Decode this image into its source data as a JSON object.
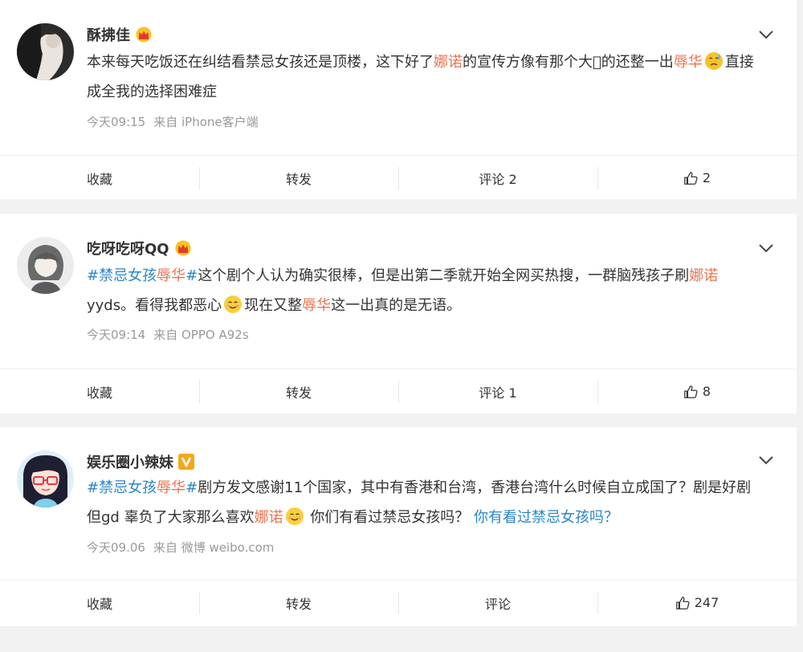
{
  "posts": [
    {
      "username": "酥拂佳",
      "badge": "crown-icon",
      "text": [
        {
          "t": "本来每天吃饭还在纠结看禁忌女孩还是顶楼，这下好了"
        },
        {
          "t": "娜诺",
          "c": "hl"
        },
        {
          "t": "的宣传方像有那个大𫠠的还整一出"
        },
        {
          "t": "辱华",
          "c": "hl"
        },
        {
          "emoji": "sweat-emoji"
        },
        {
          "t": "直接成全我的选择困难症"
        }
      ],
      "time": "今天09:15",
      "source": "来自 iPhone客户端",
      "actions": {
        "favorite": "收藏",
        "repost": "转发",
        "comment": "评论 2",
        "like": "2"
      }
    },
    {
      "username": "吃呀吃呀QQ",
      "badge": "crown-icon",
      "text": [
        {
          "t": "#禁忌女孩",
          "c": "tag"
        },
        {
          "t": "辱华",
          "c": "hl"
        },
        {
          "t": "#",
          "c": "tag"
        },
        {
          "t": "这个剧个人认为确实很棒，但是出第二季就开始全网买热搜，一群脑残孩子刷"
        },
        {
          "t": "娜诺",
          "c": "hl"
        },
        {
          "t": "yyds。看得我都恶心"
        },
        {
          "emoji": "smile-emoji"
        },
        {
          "t": "现在又整"
        },
        {
          "t": "辱华",
          "c": "hl"
        },
        {
          "t": "这一出真的是无语。"
        }
      ],
      "time": "今天09:14",
      "source": "来自 OPPO A92s",
      "actions": {
        "favorite": "收藏",
        "repost": "转发",
        "comment": "评论 1",
        "like": "8"
      }
    },
    {
      "username": "娱乐圈小辣妹",
      "badge": "verified-v-icon",
      "text": [
        {
          "t": "#禁忌女孩",
          "c": "tag"
        },
        {
          "t": "辱华",
          "c": "hl"
        },
        {
          "t": "#",
          "c": "tag"
        },
        {
          "t": "剧方发文感谢11个国家，其中有香港和台湾，香港台湾什么时候自立成国了？剧是好剧但gd 辜负了大家那么喜欢"
        },
        {
          "t": "娜诺",
          "c": "hl"
        },
        {
          "emoji": "smile-emoji"
        },
        {
          "t": " 你们有看过禁忌女孩吗？ "
        },
        {
          "t": "你有看过禁忌女孩吗？",
          "c": "link"
        }
      ],
      "time": "今天09.06",
      "source": "来自 微博 weibo.com",
      "actions": {
        "favorite": "收藏",
        "repost": "转发",
        "comment": "评论",
        "like": "247"
      }
    }
  ],
  "colors": {
    "highlight": "#eb7350",
    "tag": "#2a86ca",
    "meta": "#999999"
  }
}
